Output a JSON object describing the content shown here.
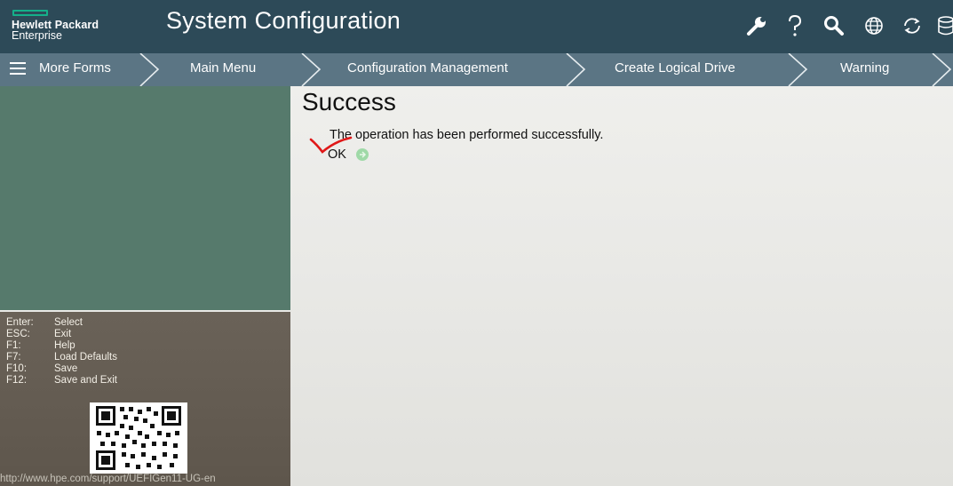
{
  "header": {
    "logo_line1": "Hewlett Packard",
    "logo_line2": "Enterprise",
    "title": "System Configuration",
    "icons": [
      "wrench-icon",
      "help-icon",
      "search-icon",
      "globe-icon",
      "refresh-icon",
      "database-icon"
    ]
  },
  "breadcrumbs": {
    "menu_label": "More Forms",
    "items": [
      "Main Menu",
      "Configuration Management",
      "Create Logical Drive",
      "Warning"
    ]
  },
  "content": {
    "title": "Success",
    "message": "The operation has been performed successfully.",
    "ok_label": "OK"
  },
  "keys": [
    {
      "key": "Enter:",
      "action": "Select"
    },
    {
      "key": "ESC:",
      "action": "Exit"
    },
    {
      "key": "F1:",
      "action": "Help"
    },
    {
      "key": "F7:",
      "action": "Load Defaults"
    },
    {
      "key": "F10:",
      "action": "Save"
    },
    {
      "key": "F12:",
      "action": "Save and Exit"
    }
  ],
  "support_url": "http://www.hpe.com/support/UEFIGen11-UG-en",
  "colors": {
    "header": "#2d4a58",
    "breadcrumb": "#5b7584",
    "left_top": "#567a6c",
    "left_bottom": "#665e54",
    "accent": "#15b08a"
  }
}
